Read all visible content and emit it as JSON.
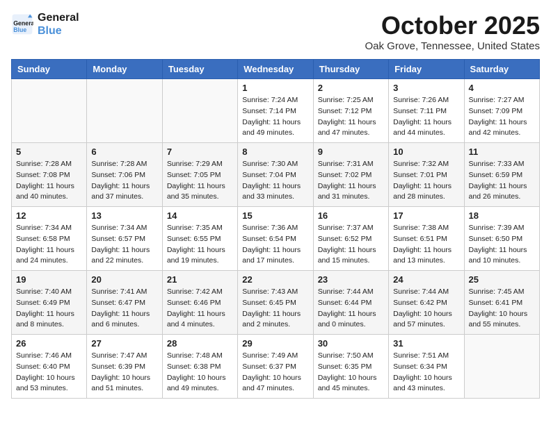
{
  "header": {
    "logo_line1": "General",
    "logo_line2": "Blue",
    "month": "October 2025",
    "location": "Oak Grove, Tennessee, United States"
  },
  "days_of_week": [
    "Sunday",
    "Monday",
    "Tuesday",
    "Wednesday",
    "Thursday",
    "Friday",
    "Saturday"
  ],
  "weeks": [
    [
      {
        "day": "",
        "info": ""
      },
      {
        "day": "",
        "info": ""
      },
      {
        "day": "",
        "info": ""
      },
      {
        "day": "1",
        "info": "Sunrise: 7:24 AM\nSunset: 7:14 PM\nDaylight: 11 hours and 49 minutes."
      },
      {
        "day": "2",
        "info": "Sunrise: 7:25 AM\nSunset: 7:12 PM\nDaylight: 11 hours and 47 minutes."
      },
      {
        "day": "3",
        "info": "Sunrise: 7:26 AM\nSunset: 7:11 PM\nDaylight: 11 hours and 44 minutes."
      },
      {
        "day": "4",
        "info": "Sunrise: 7:27 AM\nSunset: 7:09 PM\nDaylight: 11 hours and 42 minutes."
      }
    ],
    [
      {
        "day": "5",
        "info": "Sunrise: 7:28 AM\nSunset: 7:08 PM\nDaylight: 11 hours and 40 minutes."
      },
      {
        "day": "6",
        "info": "Sunrise: 7:28 AM\nSunset: 7:06 PM\nDaylight: 11 hours and 37 minutes."
      },
      {
        "day": "7",
        "info": "Sunrise: 7:29 AM\nSunset: 7:05 PM\nDaylight: 11 hours and 35 minutes."
      },
      {
        "day": "8",
        "info": "Sunrise: 7:30 AM\nSunset: 7:04 PM\nDaylight: 11 hours and 33 minutes."
      },
      {
        "day": "9",
        "info": "Sunrise: 7:31 AM\nSunset: 7:02 PM\nDaylight: 11 hours and 31 minutes."
      },
      {
        "day": "10",
        "info": "Sunrise: 7:32 AM\nSunset: 7:01 PM\nDaylight: 11 hours and 28 minutes."
      },
      {
        "day": "11",
        "info": "Sunrise: 7:33 AM\nSunset: 6:59 PM\nDaylight: 11 hours and 26 minutes."
      }
    ],
    [
      {
        "day": "12",
        "info": "Sunrise: 7:34 AM\nSunset: 6:58 PM\nDaylight: 11 hours and 24 minutes."
      },
      {
        "day": "13",
        "info": "Sunrise: 7:34 AM\nSunset: 6:57 PM\nDaylight: 11 hours and 22 minutes."
      },
      {
        "day": "14",
        "info": "Sunrise: 7:35 AM\nSunset: 6:55 PM\nDaylight: 11 hours and 19 minutes."
      },
      {
        "day": "15",
        "info": "Sunrise: 7:36 AM\nSunset: 6:54 PM\nDaylight: 11 hours and 17 minutes."
      },
      {
        "day": "16",
        "info": "Sunrise: 7:37 AM\nSunset: 6:52 PM\nDaylight: 11 hours and 15 minutes."
      },
      {
        "day": "17",
        "info": "Sunrise: 7:38 AM\nSunset: 6:51 PM\nDaylight: 11 hours and 13 minutes."
      },
      {
        "day": "18",
        "info": "Sunrise: 7:39 AM\nSunset: 6:50 PM\nDaylight: 11 hours and 10 minutes."
      }
    ],
    [
      {
        "day": "19",
        "info": "Sunrise: 7:40 AM\nSunset: 6:49 PM\nDaylight: 11 hours and 8 minutes."
      },
      {
        "day": "20",
        "info": "Sunrise: 7:41 AM\nSunset: 6:47 PM\nDaylight: 11 hours and 6 minutes."
      },
      {
        "day": "21",
        "info": "Sunrise: 7:42 AM\nSunset: 6:46 PM\nDaylight: 11 hours and 4 minutes."
      },
      {
        "day": "22",
        "info": "Sunrise: 7:43 AM\nSunset: 6:45 PM\nDaylight: 11 hours and 2 minutes."
      },
      {
        "day": "23",
        "info": "Sunrise: 7:44 AM\nSunset: 6:44 PM\nDaylight: 11 hours and 0 minutes."
      },
      {
        "day": "24",
        "info": "Sunrise: 7:44 AM\nSunset: 6:42 PM\nDaylight: 10 hours and 57 minutes."
      },
      {
        "day": "25",
        "info": "Sunrise: 7:45 AM\nSunset: 6:41 PM\nDaylight: 10 hours and 55 minutes."
      }
    ],
    [
      {
        "day": "26",
        "info": "Sunrise: 7:46 AM\nSunset: 6:40 PM\nDaylight: 10 hours and 53 minutes."
      },
      {
        "day": "27",
        "info": "Sunrise: 7:47 AM\nSunset: 6:39 PM\nDaylight: 10 hours and 51 minutes."
      },
      {
        "day": "28",
        "info": "Sunrise: 7:48 AM\nSunset: 6:38 PM\nDaylight: 10 hours and 49 minutes."
      },
      {
        "day": "29",
        "info": "Sunrise: 7:49 AM\nSunset: 6:37 PM\nDaylight: 10 hours and 47 minutes."
      },
      {
        "day": "30",
        "info": "Sunrise: 7:50 AM\nSunset: 6:35 PM\nDaylight: 10 hours and 45 minutes."
      },
      {
        "day": "31",
        "info": "Sunrise: 7:51 AM\nSunset: 6:34 PM\nDaylight: 10 hours and 43 minutes."
      },
      {
        "day": "",
        "info": ""
      }
    ]
  ]
}
